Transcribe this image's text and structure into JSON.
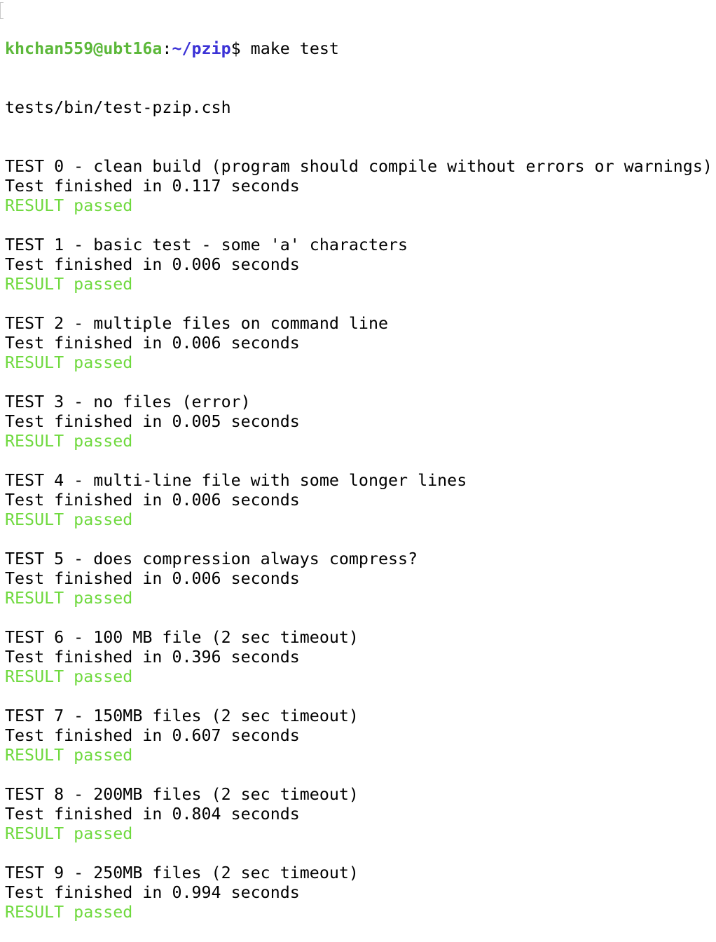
{
  "prompt": {
    "user_host": "khchan559@ubt16a",
    "separator": ":",
    "path": "~/pzip",
    "symbol": "$",
    "command": " make test"
  },
  "script_line": "tests/bin/test-pzip.csh",
  "tests": [
    {
      "header": "TEST 0 - clean build (program should compile without errors or warnings)",
      "finished": "Test finished in 0.117 seconds",
      "result": "RESULT passed"
    },
    {
      "header": "TEST 1 - basic test - some 'a' characters",
      "finished": "Test finished in 0.006 seconds",
      "result": "RESULT passed"
    },
    {
      "header": "TEST 2 - multiple files on command line",
      "finished": "Test finished in 0.006 seconds",
      "result": "RESULT passed"
    },
    {
      "header": "TEST 3 - no files (error)",
      "finished": "Test finished in 0.005 seconds",
      "result": "RESULT passed"
    },
    {
      "header": "TEST 4 - multi-line file with some longer lines",
      "finished": "Test finished in 0.006 seconds",
      "result": "RESULT passed"
    },
    {
      "header": "TEST 5 - does compression always compress?",
      "finished": "Test finished in 0.006 seconds",
      "result": "RESULT passed"
    },
    {
      "header": "TEST 6 - 100 MB file (2 sec timeout)",
      "finished": "Test finished in 0.396 seconds",
      "result": "RESULT passed"
    },
    {
      "header": "TEST 7 - 150MB files (2 sec timeout)",
      "finished": "Test finished in 0.607 seconds",
      "result": "RESULT passed"
    },
    {
      "header": "TEST 8 - 200MB files (2 sec timeout)",
      "finished": "Test finished in 0.804 seconds",
      "result": "RESULT passed"
    },
    {
      "header": "TEST 9 - 250MB files (2 sec timeout)",
      "finished": "Test finished in 0.994 seconds",
      "result": "RESULT passed"
    }
  ],
  "colors": {
    "user_host": "#5cb83a",
    "path": "#3b32d6",
    "passed": "#6fd93e",
    "text": "#000000",
    "background": "#ffffff"
  }
}
